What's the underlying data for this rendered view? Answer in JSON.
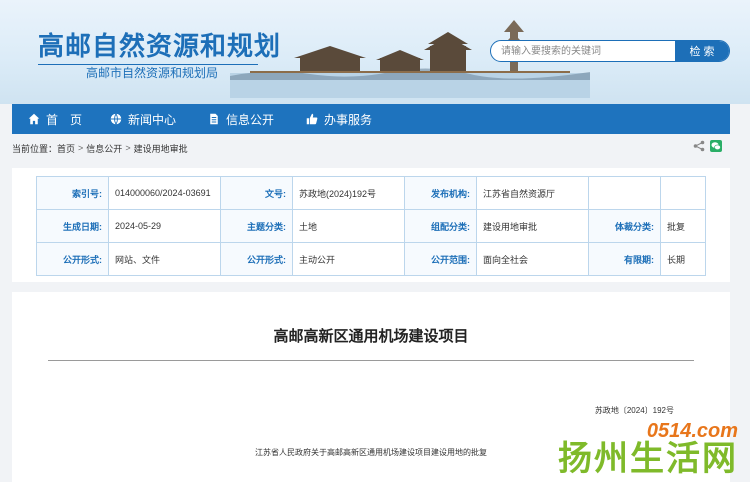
{
  "header": {
    "title": "高邮自然资源和规划",
    "subtitle": "高邮市自然资源和规划局",
    "search": {
      "placeholder": "请输入要搜索的关键词",
      "button": "检 索"
    }
  },
  "nav": {
    "items": [
      {
        "label": "首　页",
        "icon": "home-icon"
      },
      {
        "label": "新闻中心",
        "icon": "globe-icon"
      },
      {
        "label": "信息公开",
        "icon": "document-icon"
      },
      {
        "label": "办事服务",
        "icon": "thumbs-up-icon"
      }
    ]
  },
  "breadcrumb": {
    "prefix": "当前位置：",
    "items": [
      "首页",
      "信息公开",
      "建设用地审批"
    ],
    "separator": ">"
  },
  "meta": {
    "rows": [
      [
        {
          "k": "索引号:",
          "v": "014000060/2024-03691"
        },
        {
          "k": "文号:",
          "v": "苏政地(2024)192号"
        },
        {
          "k": "发布机构:",
          "v": "江苏省自然资源厅"
        },
        {
          "k": "",
          "v": ""
        }
      ],
      [
        {
          "k": "生成日期:",
          "v": "2024-05-29"
        },
        {
          "k": "主题分类:",
          "v": "土地"
        },
        {
          "k": "组配分类:",
          "v": "建设用地审批"
        },
        {
          "k": "体裁分类:",
          "v": "批复"
        }
      ],
      [
        {
          "k": "公开形式:",
          "v": "网站、文件"
        },
        {
          "k": "公开形式:",
          "v": "主动公开"
        },
        {
          "k": "公开范围:",
          "v": "面向全社会"
        },
        {
          "k": "有限期:",
          "v": "长期"
        }
      ]
    ]
  },
  "article": {
    "title": "高邮高新区通用机场建设项目",
    "doc_number": "苏政地〔2024〕192号",
    "first_line": "江苏省人民政府关于高邮高新区通用机场建设项目建设用地的批复"
  },
  "watermark": {
    "small": "0514.com",
    "big": "扬州生活网"
  },
  "colors": {
    "primary": "#1e73be",
    "watermark_orange": "#e8761b",
    "watermark_green": "#7fba2a"
  }
}
